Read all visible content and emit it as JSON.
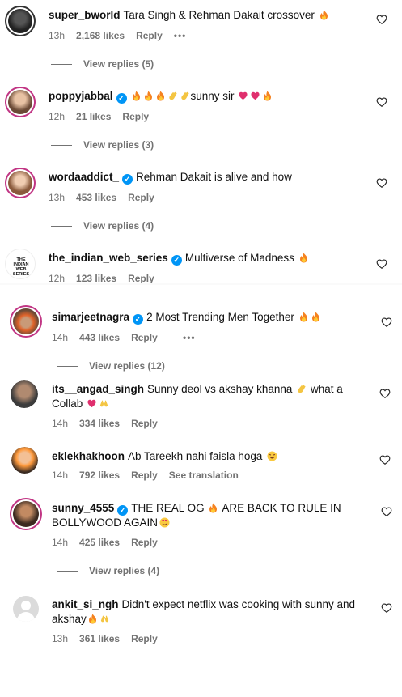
{
  "comments": [
    {
      "user": "super_bworld",
      "verified": false,
      "text": "Tara Singh & Rehman Dakait crossover",
      "time": "13h",
      "likes": "2,168 likes",
      "reply": "Reply",
      "more": "•••",
      "view_replies": "View replies (5)"
    },
    {
      "user": "poppyjabbal",
      "verified": true,
      "text": "sunny sir",
      "time": "12h",
      "likes": "21 likes",
      "reply": "Reply",
      "view_replies": "View replies (3)"
    },
    {
      "user": "wordaaddict_",
      "verified": true,
      "text": "Rehman Dakait is alive and how",
      "time": "13h",
      "likes": "453 likes",
      "reply": "Reply",
      "view_replies": "View replies (4)"
    },
    {
      "user": "the_indian_web_series",
      "verified": true,
      "text": "Multiverse of Madness",
      "time": "12h",
      "likes": "123 likes",
      "reply": "Reply"
    },
    {
      "user": "simarjeetnagra",
      "verified": true,
      "text": "2 Most Trending Men Together",
      "time": "14h",
      "likes": "443 likes",
      "reply": "Reply",
      "view_replies": "View replies (12)"
    },
    {
      "user": "its__angad_singh",
      "verified": false,
      "text": "Sunny deol vs akshay khanna",
      "text2": "what a Collab",
      "time": "14h",
      "likes": "334 likes",
      "reply": "Reply"
    },
    {
      "user": "eklekhakhoon",
      "verified": false,
      "text": "Ab Tareekh nahi faisla hoga",
      "time": "14h",
      "likes": "792 likes",
      "reply": "Reply",
      "translate": "See translation"
    },
    {
      "user": "sunny_4555",
      "verified": true,
      "text": "THE REAL OG",
      "text2": "ARE BACK TO RULE IN BOLLYWOOD AGAIN",
      "time": "14h",
      "likes": "425 likes",
      "reply": "Reply",
      "view_replies": "View replies (4)"
    },
    {
      "user": "ankit_si_ngh",
      "verified": false,
      "text": "Didn't expect netflix was cooking with sunny and akshay",
      "time": "13h",
      "likes": "361 likes",
      "reply": "Reply"
    }
  ],
  "avatar_logo_text": "THE INDIAN WEB SERIES",
  "colors": {
    "story_ring": "#c13584",
    "verified": "#0095f6",
    "meta": "#737373",
    "heart_red": "#ed4956",
    "fire": "#f58220"
  }
}
